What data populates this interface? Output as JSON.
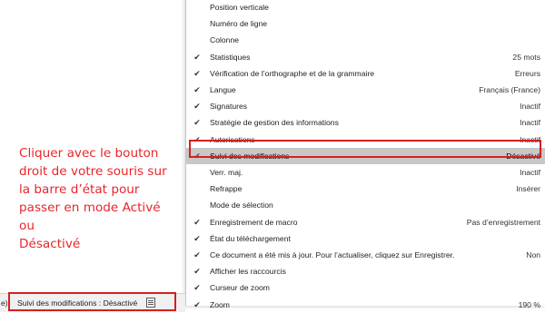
{
  "annotation": {
    "lines": [
      "Cliquer avec le bouton",
      "droit de votre souris sur",
      "la barre d’état pour",
      "passer en mode Activé ou",
      "Désactivé"
    ]
  },
  "menu": {
    "items": [
      {
        "label": "Position verticale",
        "value": "",
        "checked": false
      },
      {
        "label": "Numéro de ligne",
        "value": "",
        "checked": false
      },
      {
        "label": "Colonne",
        "value": "",
        "checked": false
      },
      {
        "label": "Statistiques",
        "value": "25 mots",
        "checked": true
      },
      {
        "label": "Vérification de l’orthographe et de la grammaire",
        "value": "Erreurs",
        "checked": true
      },
      {
        "label": "Langue",
        "value": "Français (France)",
        "checked": true
      },
      {
        "label": "Signatures",
        "value": "Inactif",
        "checked": true
      },
      {
        "label": "Stratégie de gestion des informations",
        "value": "Inactif",
        "checked": true
      },
      {
        "label": "Autorisations",
        "value": "Inactif",
        "checked": true
      },
      {
        "label": "Suivi des modifications",
        "value": "Désactivé",
        "checked": true,
        "highlighted": true
      },
      {
        "label": "Verr. maj.",
        "value": "Inactif",
        "checked": false
      },
      {
        "label": "Refrappe",
        "value": "Insérer",
        "checked": false
      },
      {
        "label": "Mode de sélection",
        "value": "",
        "checked": false
      },
      {
        "label": "Enregistrement de macro",
        "value": "Pas d’enregistrement",
        "checked": true
      },
      {
        "label": "État du téléchargement",
        "value": "",
        "checked": true
      },
      {
        "label": "Ce document a été mis à jour. Pour l’actualiser, cliquez sur Enregistrer.",
        "value": "Non",
        "checked": true
      },
      {
        "label": "Afficher les raccourcis",
        "value": "",
        "checked": true
      },
      {
        "label": "Curseur de zoom",
        "value": "",
        "checked": true
      },
      {
        "label": "Zoom",
        "value": "190 %",
        "checked": true
      }
    ],
    "check_glyph": "✔"
  },
  "statusbar": {
    "edge_text": "e)",
    "tracking_text": "Suivi des modifications : Désactivé",
    "icon": "page-layout-icon"
  },
  "colors": {
    "annotation": "#e8262a",
    "highlight_border": "#d42020",
    "highlight_fill": "#c8c8c8"
  }
}
